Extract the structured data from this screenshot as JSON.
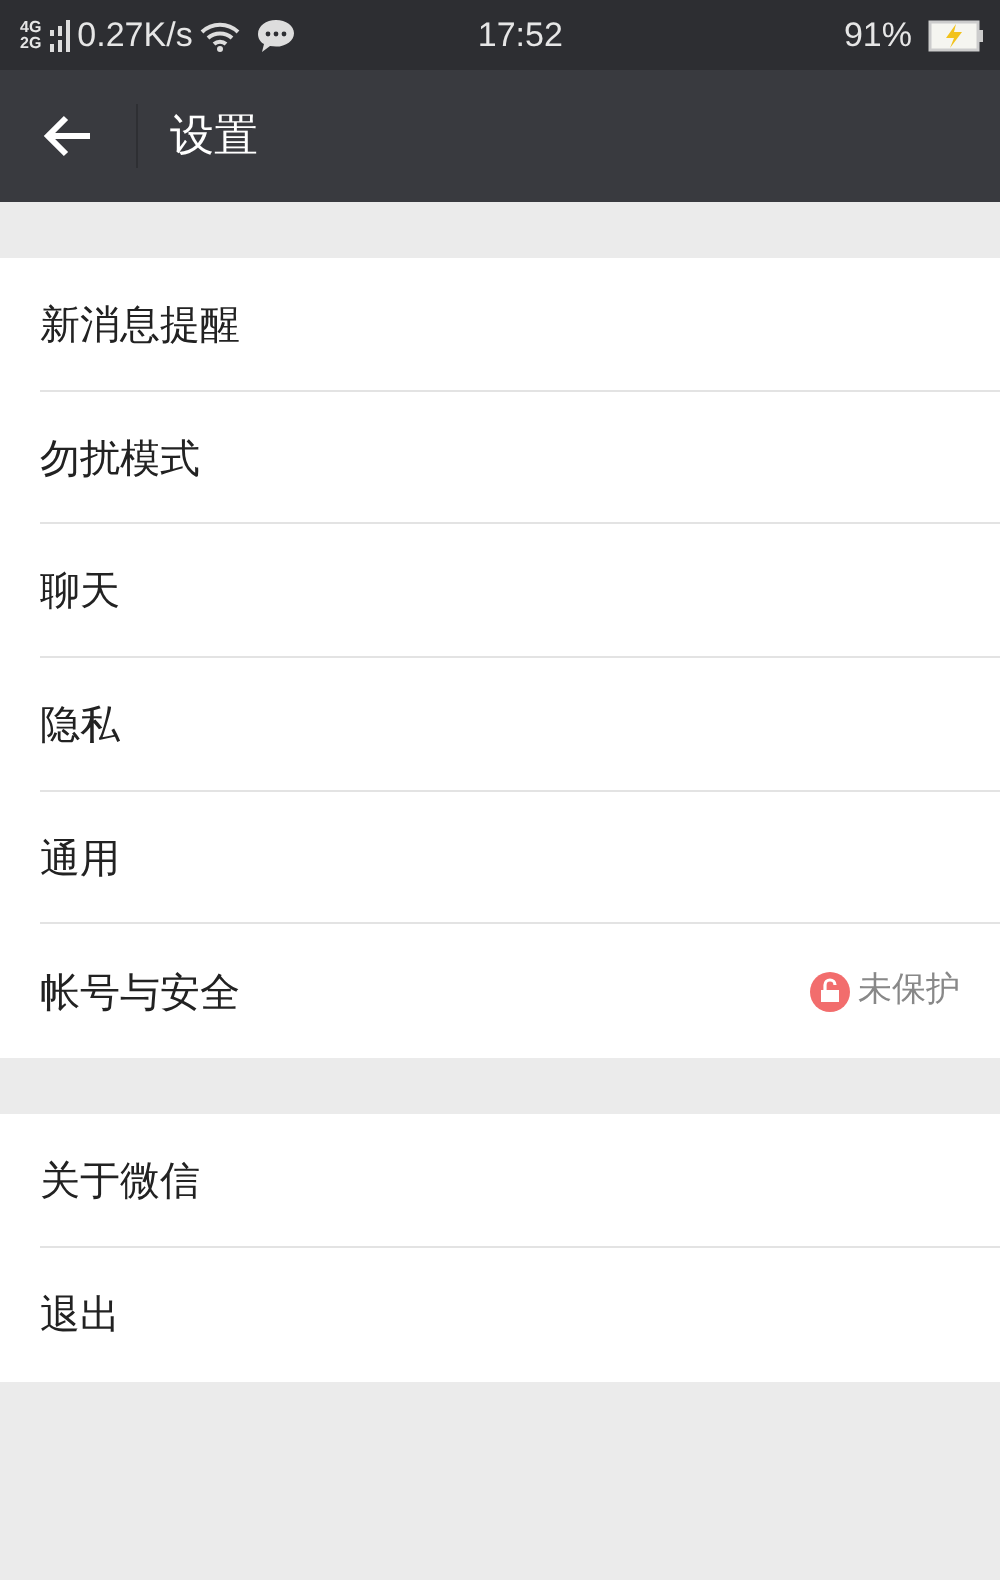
{
  "status_bar": {
    "network_top": "4G",
    "network_bottom": "2G",
    "speed": "0.27K/s",
    "time": "17:52",
    "battery": "91%"
  },
  "header": {
    "title": "设置"
  },
  "groups": [
    {
      "items": [
        {
          "label": "新消息提醒"
        },
        {
          "label": "勿扰模式"
        },
        {
          "label": "聊天"
        },
        {
          "label": "隐私"
        },
        {
          "label": "通用"
        },
        {
          "label": "帐号与安全",
          "status": "未保护"
        }
      ]
    },
    {
      "items": [
        {
          "label": "关于微信"
        },
        {
          "label": "退出"
        }
      ]
    }
  ]
}
